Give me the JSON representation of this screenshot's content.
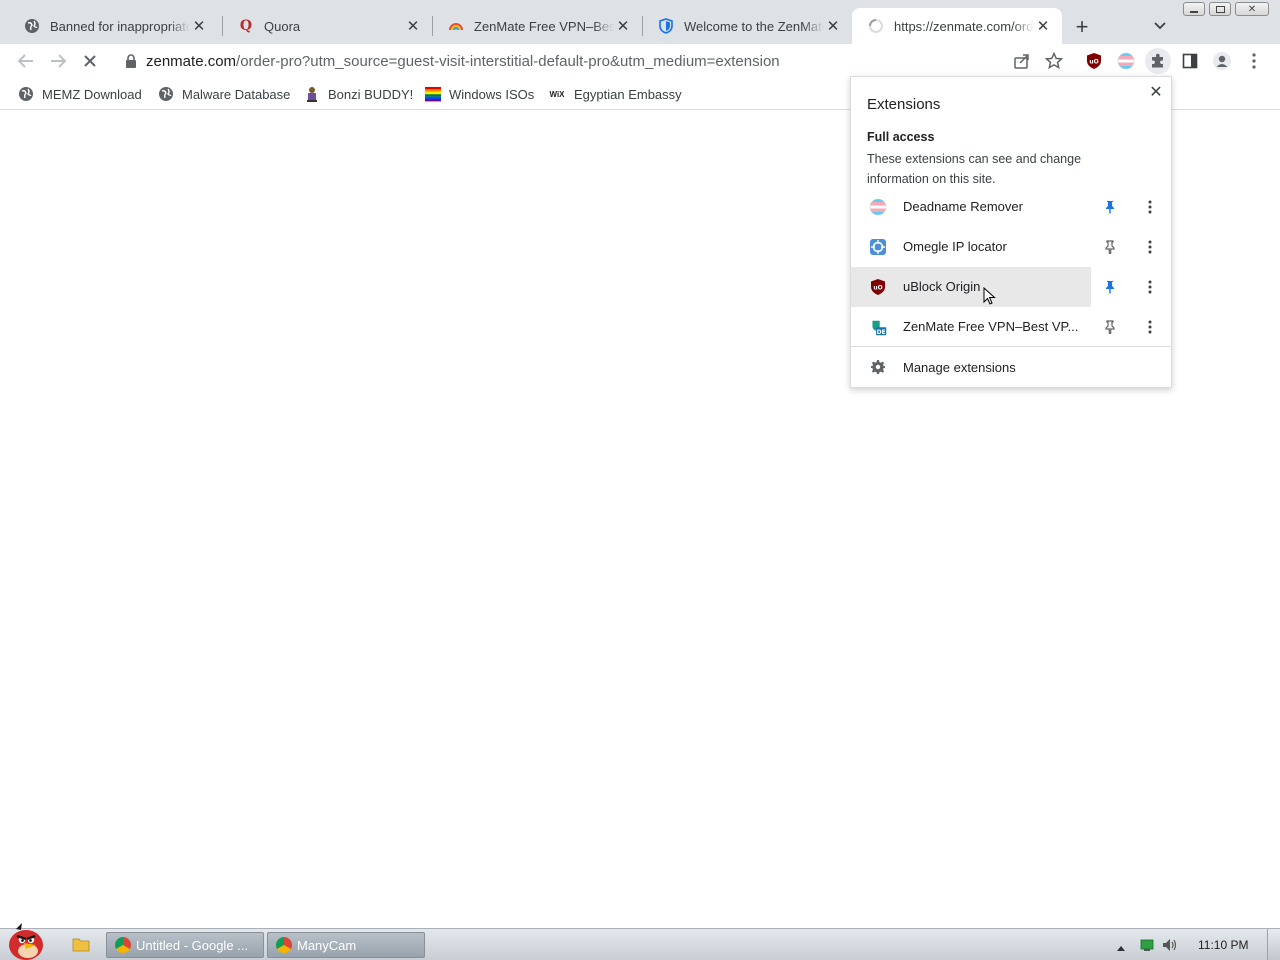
{
  "tabs": [
    {
      "title": "Banned for inappropriate",
      "icon": "globe-icon",
      "close": "✕"
    },
    {
      "title": "Quora",
      "icon": "quora-icon",
      "close": "✕"
    },
    {
      "title": "ZenMate Free VPN–Best",
      "icon": "zenmate-rainbow-icon",
      "close": "✕"
    },
    {
      "title": "Welcome to the ZenMate",
      "icon": "shield-icon",
      "close": "✕"
    },
    {
      "title": "https://zenmate.com/orde",
      "icon": "loading-spinner-icon",
      "close": "✕",
      "active": true
    }
  ],
  "new_tab_label": "+",
  "toolbar": {
    "url_host": "zenmate.com",
    "url_path": "/order-pro?utm_source=guest-visit-interstitial-default-pro&utm_medium=extension"
  },
  "bookmarks": [
    {
      "label": "MEMZ Download",
      "icon": "globe-icon"
    },
    {
      "label": "Malware Database",
      "icon": "globe-icon"
    },
    {
      "label": "Bonzi BUDDY!",
      "icon": "bonzi-icon"
    },
    {
      "label": "Windows ISOs",
      "icon": "rainbow-flag-icon"
    },
    {
      "label": "Egyptian Embassy",
      "icon": "wix-icon",
      "icon_text": "WiX"
    }
  ],
  "extensions_popup": {
    "title": "Extensions",
    "close": "✕",
    "section": "Full access",
    "description": "These extensions can see and change information on this site.",
    "items": [
      {
        "name": "Deadname Remover",
        "icon": "trans-flag-icon",
        "pinned": true
      },
      {
        "name": "Omegle IP locator",
        "icon": "omegle-locator-icon",
        "pinned": false
      },
      {
        "name": "uBlock Origin",
        "icon": "ublock-icon",
        "pinned": true,
        "hovered": true
      },
      {
        "name": "ZenMate Free VPN–Best VP...",
        "icon": "zenmate-de-icon",
        "pinned": false
      }
    ],
    "manage_label": "Manage extensions"
  },
  "taskbar": {
    "tasks": [
      {
        "label": "Untitled - Google ...",
        "icon": "chrome-icon"
      },
      {
        "label": "ManyCam",
        "icon": "chrome-icon"
      }
    ],
    "clock": "11:10 PM"
  },
  "colors": {
    "pin_active": "#1a73e8",
    "pin_inactive": "#5f6368",
    "ublock_red": "#800000",
    "tab_strip": "#dee1e6"
  }
}
